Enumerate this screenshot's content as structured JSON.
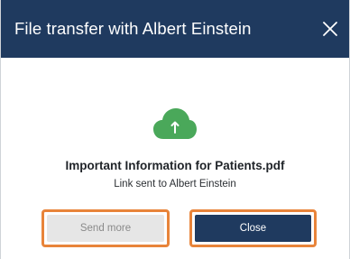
{
  "dialog": {
    "title": "File transfer with Albert Einstein",
    "close_icon": "close-icon"
  },
  "content": {
    "icon": "cloud-upload-icon",
    "file_name": "Important Information for Patients.pdf",
    "status_text": "Link sent to Albert Einstein"
  },
  "buttons": {
    "send_more_label": "Send more",
    "close_label": "Close"
  },
  "colors": {
    "header_bg": "#1f3a5f",
    "cloud_green": "#4aa85a",
    "highlight_orange": "#e8843a",
    "close_button_bg": "#1f3a5f",
    "send_more_bg": "#e6e6e6"
  }
}
